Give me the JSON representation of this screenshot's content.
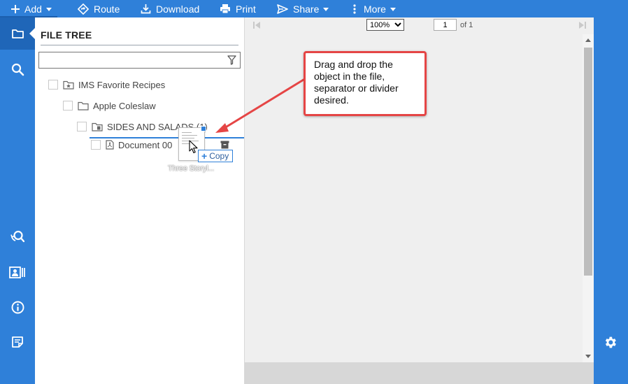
{
  "toolbar": {
    "add": "Add",
    "route": "Route",
    "download": "Download",
    "print": "Print",
    "share": "Share",
    "more": "More"
  },
  "rail": {
    "icons": [
      "folder-icon",
      "search-icon",
      "zoom-search-icon",
      "contact-card-icon",
      "info-icon",
      "note-icon"
    ]
  },
  "file_tree": {
    "title": "FILE TREE",
    "search_placeholder": "",
    "items": [
      {
        "label": "IMS Favorite Recipes",
        "icon": "starred-folder-icon"
      },
      {
        "label": "Apple Coleslaw",
        "icon": "folder-icon"
      },
      {
        "label": "SIDES AND SALADS (1)",
        "icon": "document-folder-icon"
      },
      {
        "label": "Document 00",
        "icon": "pdf-icon"
      }
    ]
  },
  "drag": {
    "ghost_label": "Three Storyl...",
    "tooltip": "Copy"
  },
  "viewer": {
    "zoom": "100%",
    "page": "1",
    "page_of": "of 1"
  },
  "callout": {
    "text": "Drag and drop the object in the file, separator or divider desired."
  },
  "colors": {
    "primary": "#2f80d9",
    "callout_border": "#e54545"
  }
}
